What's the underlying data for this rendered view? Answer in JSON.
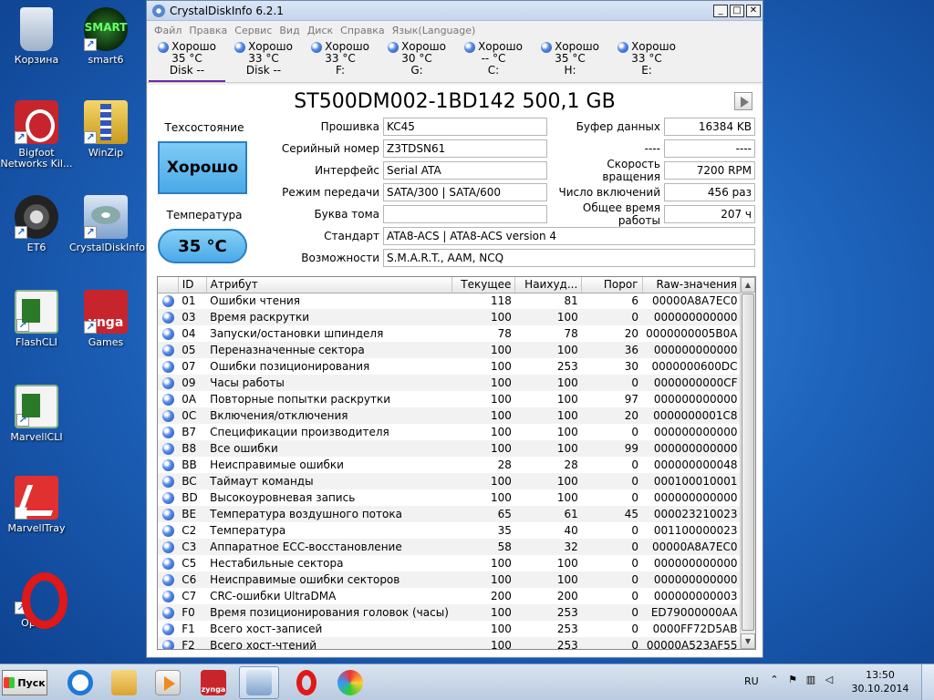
{
  "desktop": {
    "icons": [
      {
        "label": "Корзина"
      },
      {
        "label": "smart6"
      },
      {
        "label": "Bigfoot Networks Kil..."
      },
      {
        "label": "WinZip"
      },
      {
        "label": "ET6"
      },
      {
        "label": "CrystalDiskInfo"
      },
      {
        "label": "FlashCLI"
      },
      {
        "label": "Games"
      },
      {
        "label": "MarvellCLI"
      },
      {
        "label": "MarvellTray"
      },
      {
        "label": "Opera"
      }
    ],
    "smart_logo_text": "SMART",
    "games_logo_text": "ynga"
  },
  "window": {
    "title": "CrystalDiskInfo 6.2.1",
    "minimize": "_",
    "maximize": "□",
    "close": "✕",
    "menu": [
      "Файл",
      "Правка",
      "Сервис",
      "Вид",
      "Диск",
      "Справка",
      "Язык(Language)"
    ]
  },
  "disks": [
    {
      "status": "Хорошо",
      "temp": "35 °C",
      "name": "Disk --"
    },
    {
      "status": "Хорошо",
      "temp": "33 °C",
      "name": "Disk --"
    },
    {
      "status": "Хорошо",
      "temp": "33 °C",
      "name": "F:"
    },
    {
      "status": "Хорошо",
      "temp": "30 °C",
      "name": "G:"
    },
    {
      "status": "Хорошо",
      "temp": "-- °C",
      "name": "C:"
    },
    {
      "status": "Хорошо",
      "temp": "35 °C",
      "name": "H:"
    },
    {
      "status": "Хорошо",
      "temp": "33 °C",
      "name": "E:"
    }
  ],
  "drive": {
    "model": "ST500DM002-1BD142 500,1 GB",
    "health_label": "Техсостояние",
    "health_value": "Хорошо",
    "temp_label": "Температура",
    "temp_value": "35 °C",
    "fields": {
      "firmware_label": "Прошивка",
      "firmware": "KC45",
      "serial_label": "Серийный номер",
      "serial": "Z3TDSN61",
      "interface_label": "Интерфейс",
      "interface": "Serial ATA",
      "transfer_label": "Режим передачи",
      "transfer": "SATA/300 | SATA/600",
      "letter_label": "Буква тома",
      "letter": "",
      "standard_label": "Стандарт",
      "standard": "ATA8-ACS | ATA8-ACS version 4",
      "features_label": "Возможности",
      "features": "S.M.A.R.T., AAM, NCQ",
      "buffer_label": "Буфер данных",
      "buffer": "16384 KB",
      "unknown_label": "----",
      "unknown": "----",
      "rpm_label": "Скорость вращения",
      "rpm": "7200 RPM",
      "power_count_label": "Число включений",
      "power_count": "456 раз",
      "power_hours_label": "Общее время работы",
      "power_hours": "207 ч"
    }
  },
  "smart_table": {
    "headers": [
      "ID",
      "Атрибут",
      "Текущее",
      "Наихуд...",
      "Порог",
      "Raw-значения"
    ],
    "rows": [
      [
        "01",
        "Ошибки чтения",
        "118",
        "81",
        "6",
        "00000A8A7EC0"
      ],
      [
        "03",
        "Время раскрутки",
        "100",
        "100",
        "0",
        "000000000000"
      ],
      [
        "04",
        "Запуски/остановки шпинделя",
        "78",
        "78",
        "20",
        "0000000005B0A"
      ],
      [
        "05",
        "Переназначенные сектора",
        "100",
        "100",
        "36",
        "000000000000"
      ],
      [
        "07",
        "Ошибки позиционирования",
        "100",
        "253",
        "30",
        "0000000600DC"
      ],
      [
        "09",
        "Часы работы",
        "100",
        "100",
        "0",
        "0000000000CF"
      ],
      [
        "0A",
        "Повторные попытки раскрутки",
        "100",
        "100",
        "97",
        "000000000000"
      ],
      [
        "0C",
        "Включения/отключения",
        "100",
        "100",
        "20",
        "0000000001C8"
      ],
      [
        "B7",
        "Спецификации производителя",
        "100",
        "100",
        "0",
        "000000000000"
      ],
      [
        "B8",
        "Все ошибки",
        "100",
        "100",
        "99",
        "000000000000"
      ],
      [
        "BB",
        "Неисправимые ошибки",
        "28",
        "28",
        "0",
        "000000000048"
      ],
      [
        "BC",
        "Таймаут команды",
        "100",
        "100",
        "0",
        "000100010001"
      ],
      [
        "BD",
        "Высокоуровневая запись",
        "100",
        "100",
        "0",
        "000000000000"
      ],
      [
        "BE",
        "Температура воздушного потока",
        "65",
        "61",
        "45",
        "000023210023"
      ],
      [
        "C2",
        "Температура",
        "35",
        "40",
        "0",
        "001100000023"
      ],
      [
        "C3",
        "Аппаратное ECC-восстановление",
        "58",
        "32",
        "0",
        "00000A8A7EC0"
      ],
      [
        "C5",
        "Нестабильные сектора",
        "100",
        "100",
        "0",
        "000000000000"
      ],
      [
        "C6",
        "Неисправимые ошибки секторов",
        "100",
        "100",
        "0",
        "000000000000"
      ],
      [
        "C7",
        "CRC-ошибки UltraDMA",
        "200",
        "200",
        "0",
        "000000000003"
      ],
      [
        "F0",
        "Время позиционирования головок (часы)",
        "100",
        "253",
        "0",
        "ED79000000AA"
      ],
      [
        "F1",
        "Всего хост-записей",
        "100",
        "253",
        "0",
        "0000FF72D5AB"
      ],
      [
        "F2",
        "Всего хост-чтений",
        "100",
        "253",
        "0",
        "00000A523AF55"
      ]
    ]
  },
  "taskbar": {
    "start_label": "Пуск",
    "lang": "RU",
    "time": "13:50",
    "date": "30.10.2014",
    "zynga_label": "zynga"
  },
  "colors": {
    "desktop": "#1f63b6",
    "health_good": "#4aa9e8",
    "status_dot": "#1a48b0"
  }
}
